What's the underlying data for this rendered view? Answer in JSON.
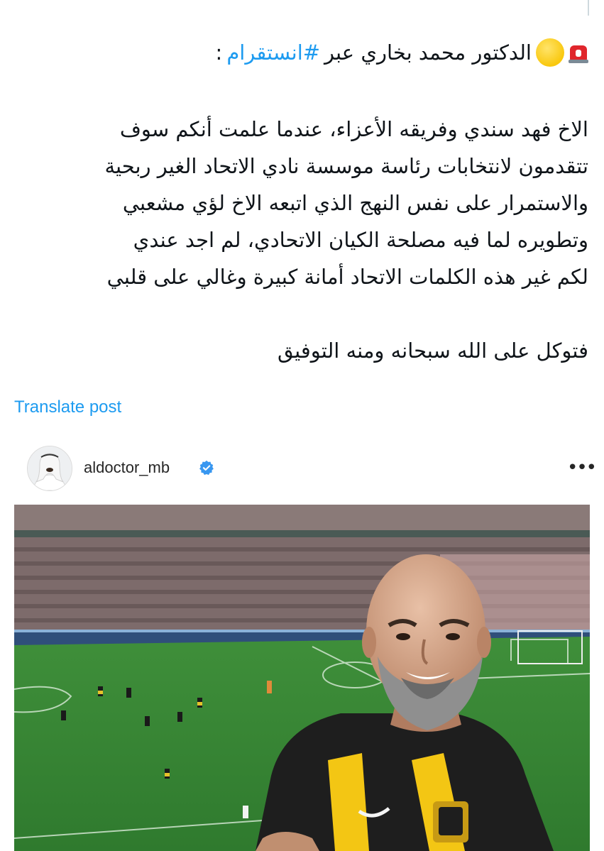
{
  "post": {
    "heading_prefix": "الدكتور محمد بخاري عبر",
    "heading_hashtag": "#انستقرام",
    "heading_suffix": ":",
    "paragraph_lines": [
      "الاخ فهد سندي وفريقه الأعزاء، عندما علمت أنكم سوف",
      "تتقدمون لانتخابات رئاسة موسسة نادي الاتحاد الغير ربحية",
      "والاستمرار على نفس النهج الذي اتبعه الاخ لؤي مشعبي",
      "وتطويره لما فيه مصلحة الكيان الاتحادي، لم اجد عندي",
      "لكم غير هذه الكلمات الاتحاد أمانة كبيرة وغالي على قلبي"
    ],
    "closing_line": "فتوكل على الله سبحانه ومنه التوفيق",
    "translate_label": "Translate post",
    "emojis": [
      "siren-emoji",
      "yellow-circle-emoji"
    ]
  },
  "instagram_embed": {
    "username": "aldoctor_mb",
    "verified": true,
    "more_label": "•••"
  },
  "colors": {
    "link": "#1d9bf0",
    "text": "#0f1419",
    "verified": "#3897f0",
    "pitch": "#3f8b3a",
    "jersey_yellow": "#f3c614"
  }
}
